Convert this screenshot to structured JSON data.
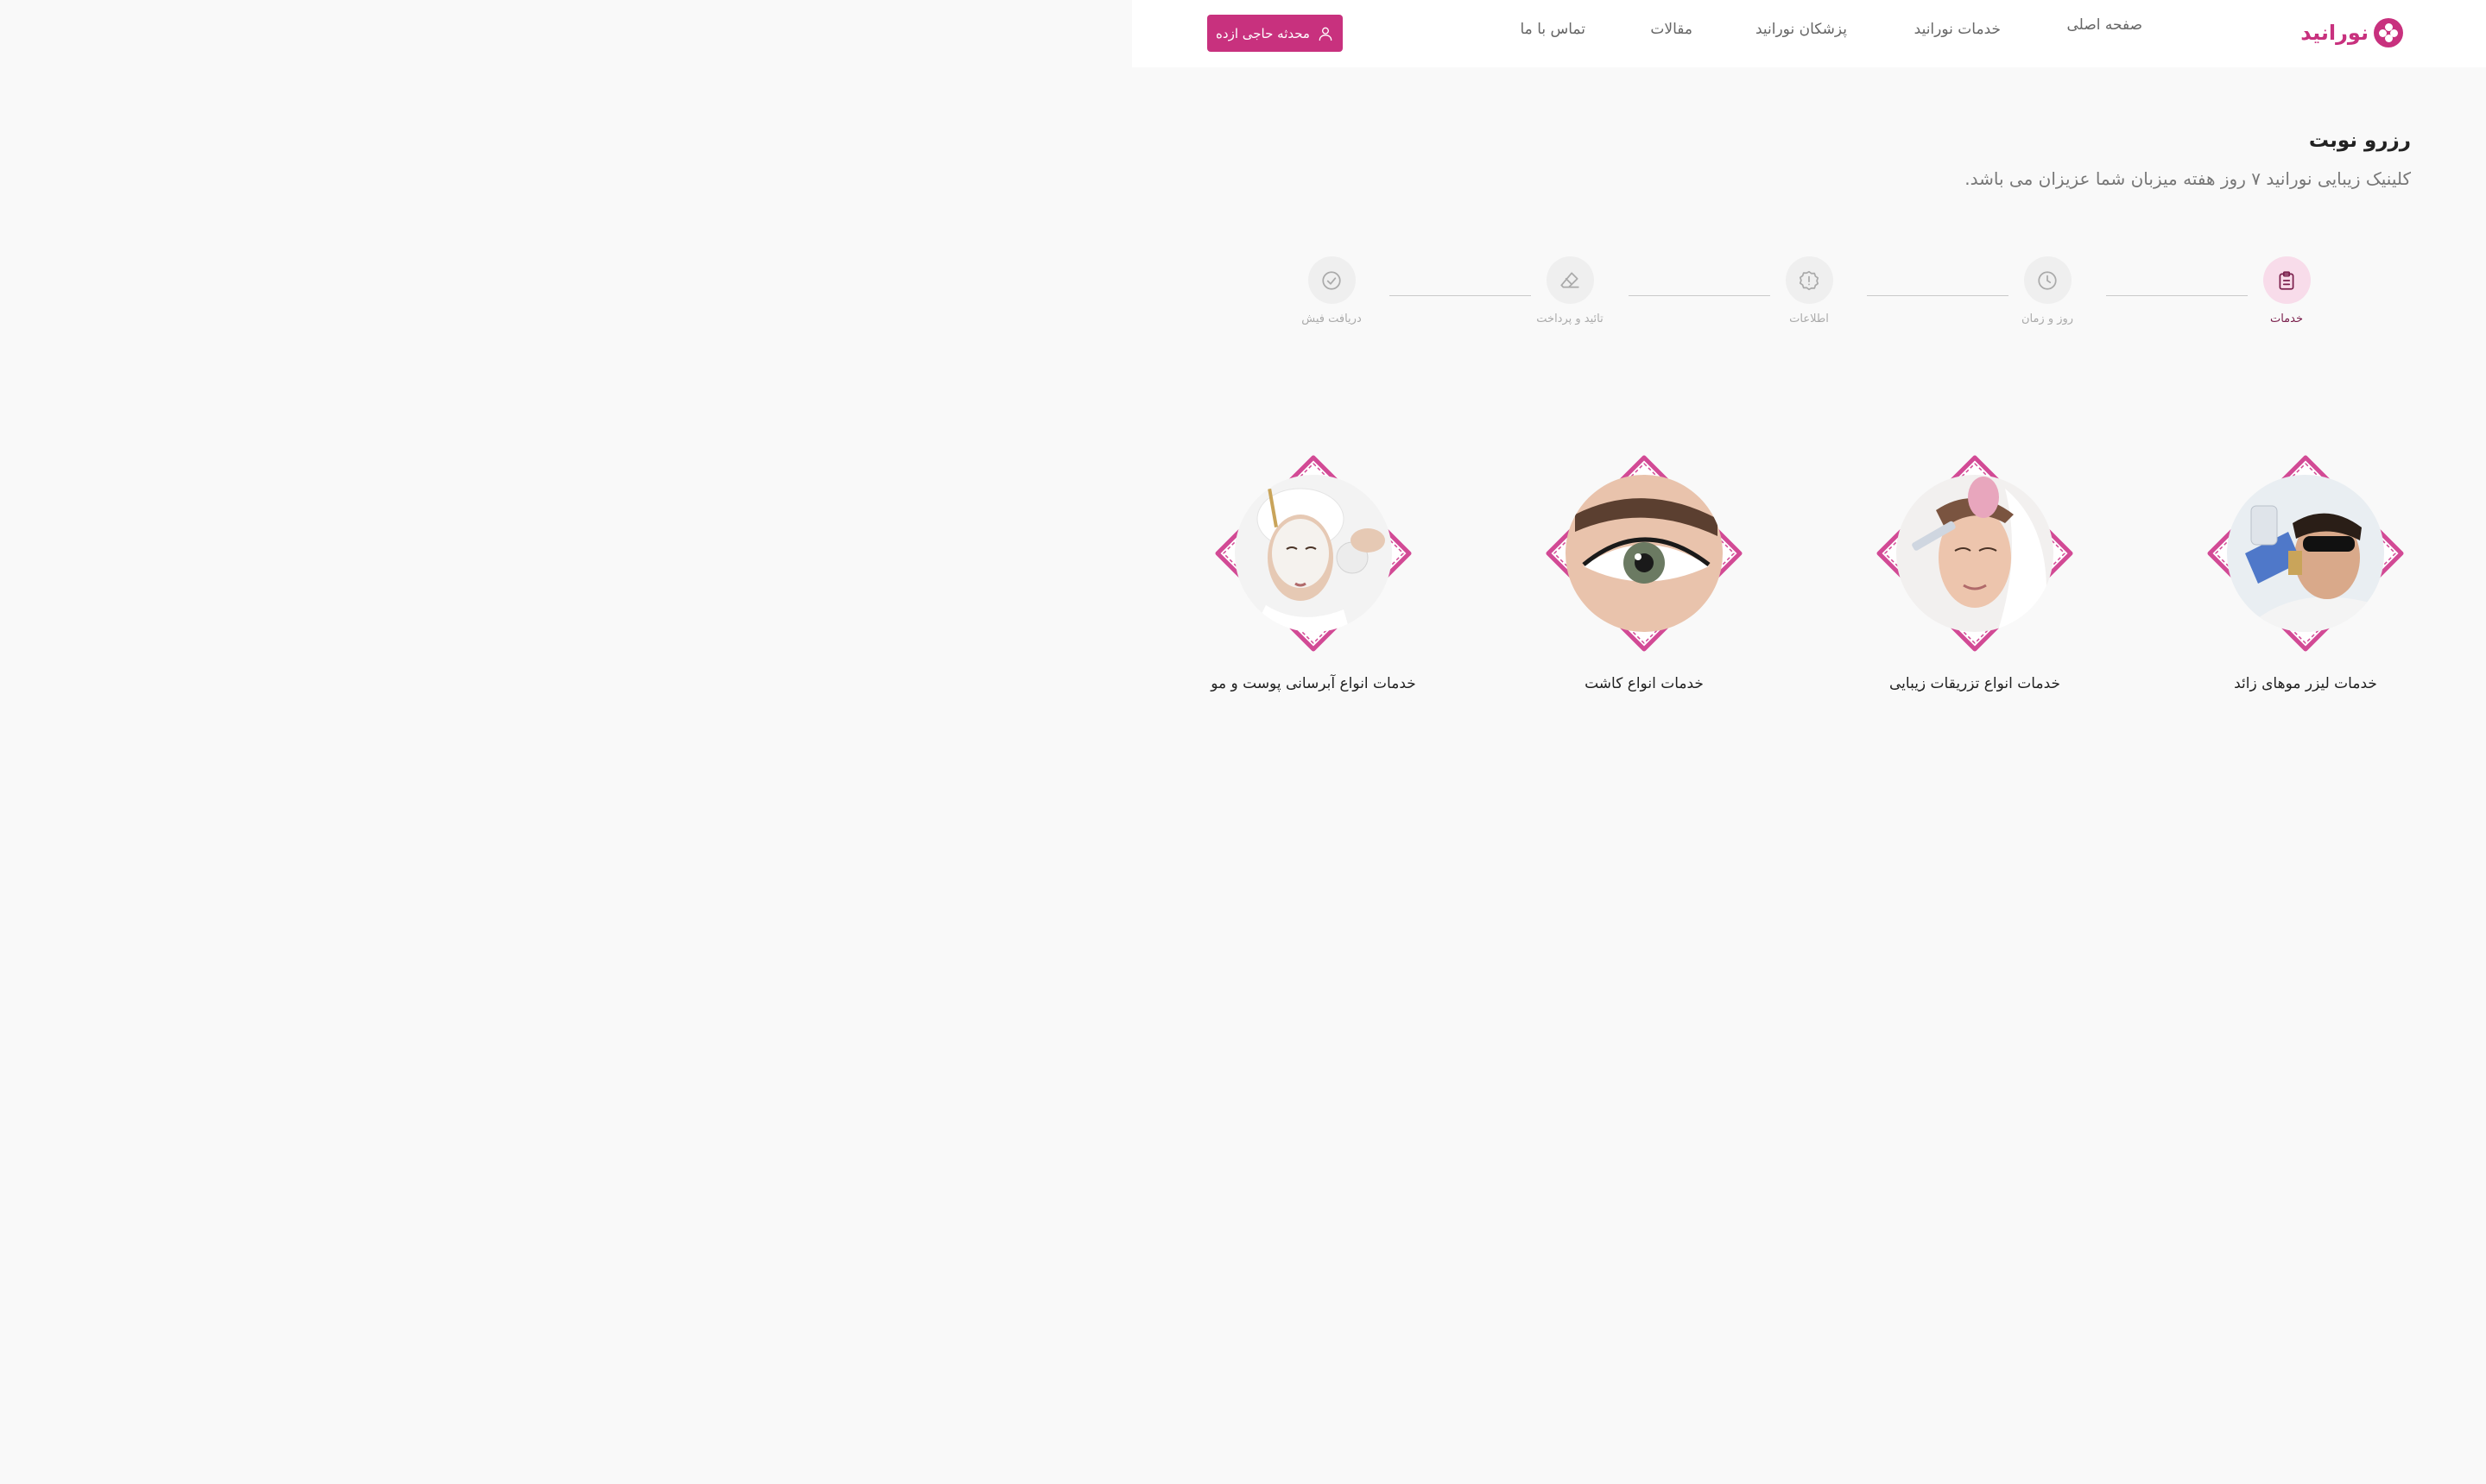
{
  "header": {
    "logo_text": "نورانید",
    "nav": [
      "صفحه اصلی",
      "خدمات نورانید",
      "پزشکان نورانید",
      "مقالات",
      "تماس با ما"
    ],
    "user_button_label": "محدثه حاجی ازده"
  },
  "hero": {
    "title": "رزرو نوبت",
    "subtitle": "کلینیک زیبایی نورانید ۷ روز هفته میزبان شما عزیزان می باشد."
  },
  "stepper": {
    "steps": [
      {
        "label": "خدمات",
        "icon": "clipboard-icon",
        "active": true
      },
      {
        "label": "روز و زمان",
        "icon": "clock-icon",
        "active": false
      },
      {
        "label": "اطلاعات",
        "icon": "alert-badge-icon",
        "active": false
      },
      {
        "label": "تائید و پرداخت",
        "icon": "eraser-icon",
        "active": false
      },
      {
        "label": "دریافت فیش",
        "icon": "check-circle-icon",
        "active": false
      }
    ]
  },
  "services": [
    {
      "label": "خدمات لیزر موهای زائد",
      "image": "laser-hair-removal-photo"
    },
    {
      "label": "خدمات انواع تزریقات زیبایی",
      "image": "beauty-injection-photo"
    },
    {
      "label": "خدمات انواع کاشت",
      "image": "eyelash-implant-photo"
    },
    {
      "label": "خدمات انواع آبرسانی پوست و مو",
      "image": "facial-mask-photo"
    }
  ],
  "colors": {
    "brand": "#c8317e",
    "active_step_bg": "#f8dcea",
    "active_step_text": "#7a1f4c",
    "page_bg": "#f9f9f9"
  }
}
